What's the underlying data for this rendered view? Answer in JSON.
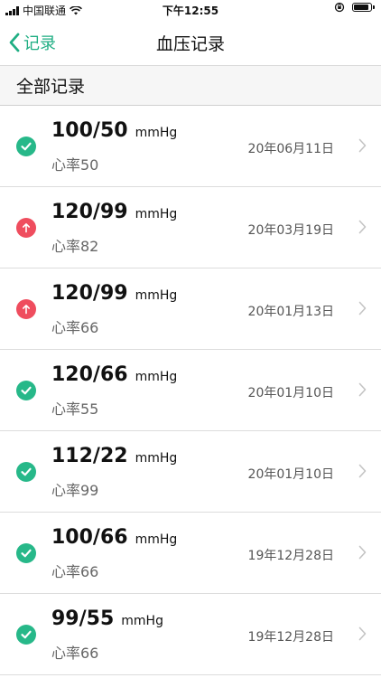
{
  "status_bar": {
    "carrier": "中国联通",
    "time": "下午12:55"
  },
  "nav": {
    "back_label": "记录",
    "title": "血压记录"
  },
  "section_title": "全部记录",
  "colors": {
    "accent": "#1fae83",
    "normal": "#27b889",
    "high": "#ef4d5e"
  },
  "records": [
    {
      "bp": "100/50",
      "unit": "mmHg",
      "heart_rate": "心率50",
      "date": "20年06月11日",
      "status": "normal",
      "icon": "check-circle-icon"
    },
    {
      "bp": "120/99",
      "unit": "mmHg",
      "heart_rate": "心率82",
      "date": "20年03月19日",
      "status": "high",
      "icon": "arrow-up-circle-icon"
    },
    {
      "bp": "120/99",
      "unit": "mmHg",
      "heart_rate": "心率66",
      "date": "20年01月13日",
      "status": "high",
      "icon": "arrow-up-circle-icon"
    },
    {
      "bp": "120/66",
      "unit": "mmHg",
      "heart_rate": "心率55",
      "date": "20年01月10日",
      "status": "normal",
      "icon": "check-circle-icon"
    },
    {
      "bp": "112/22",
      "unit": "mmHg",
      "heart_rate": "心率99",
      "date": "20年01月10日",
      "status": "normal",
      "icon": "check-circle-icon"
    },
    {
      "bp": "100/66",
      "unit": "mmHg",
      "heart_rate": "心率66",
      "date": "19年12月28日",
      "status": "normal",
      "icon": "check-circle-icon"
    },
    {
      "bp": "99/55",
      "unit": "mmHg",
      "heart_rate": "心率66",
      "date": "19年12月28日",
      "status": "normal",
      "icon": "check-circle-icon"
    }
  ]
}
